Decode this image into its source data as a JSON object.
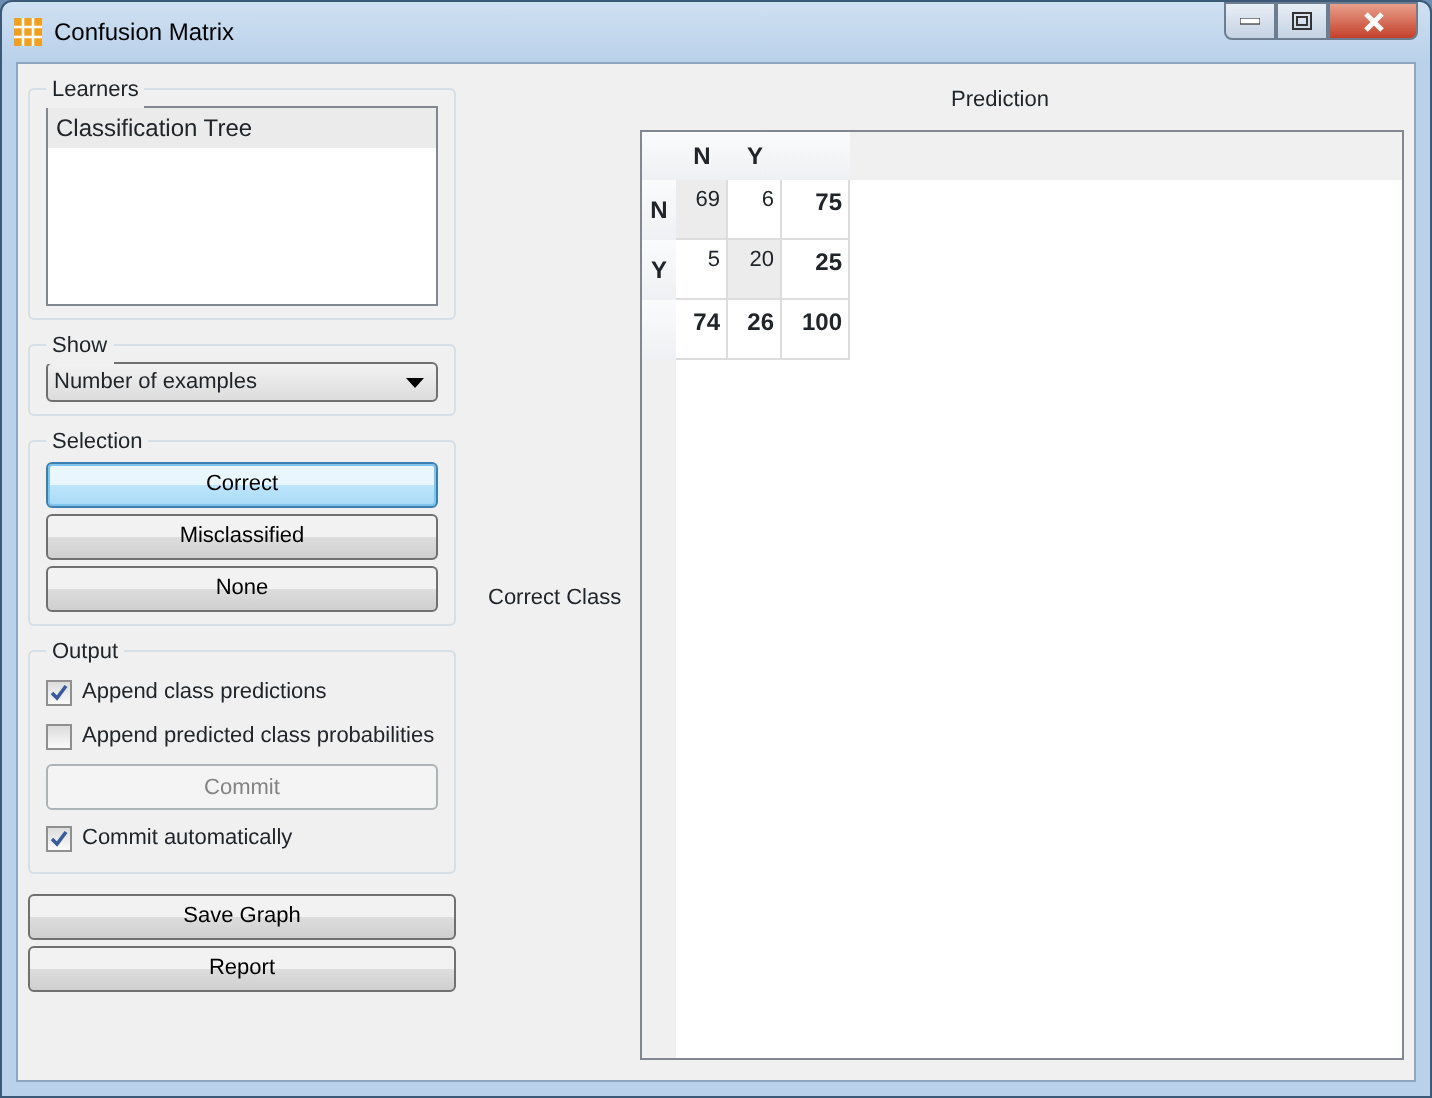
{
  "window": {
    "title": "Confusion Matrix"
  },
  "learners": {
    "title": "Learners",
    "items": [
      {
        "label": "Classification Tree",
        "selected": true
      }
    ]
  },
  "show": {
    "title": "Show",
    "value": "Number of examples"
  },
  "selection": {
    "title": "Selection",
    "buttons": [
      {
        "label": "Correct",
        "focused": true
      },
      {
        "label": "Misclassified",
        "focused": false
      },
      {
        "label": "None",
        "focused": false
      }
    ]
  },
  "output": {
    "title": "Output",
    "options": [
      {
        "kind": "checkbox",
        "label": "Append class predictions",
        "checked": true
      },
      {
        "kind": "checkbox",
        "label": "Append predicted class probabilities",
        "checked": false
      },
      {
        "kind": "button",
        "label": "Commit",
        "disabled": true
      },
      {
        "kind": "checkbox",
        "label": "Commit automatically",
        "checked": true
      }
    ]
  },
  "buttons": [
    "Save Graph",
    "Report"
  ],
  "matrix": {
    "x_title": "Prediction",
    "y_title": "Correct Class",
    "columns": [
      "N",
      "Y"
    ],
    "rows": [
      {
        "label": "N",
        "cells": [
          {
            "value": "69",
            "selected": true
          },
          {
            "value": "6",
            "selected": false
          }
        ],
        "total": "75"
      },
      {
        "label": "Y",
        "cells": [
          {
            "value": "5",
            "selected": false
          },
          {
            "value": "20",
            "selected": true
          }
        ],
        "total": "25"
      }
    ],
    "totals": [
      "74",
      "26",
      "100"
    ]
  }
}
